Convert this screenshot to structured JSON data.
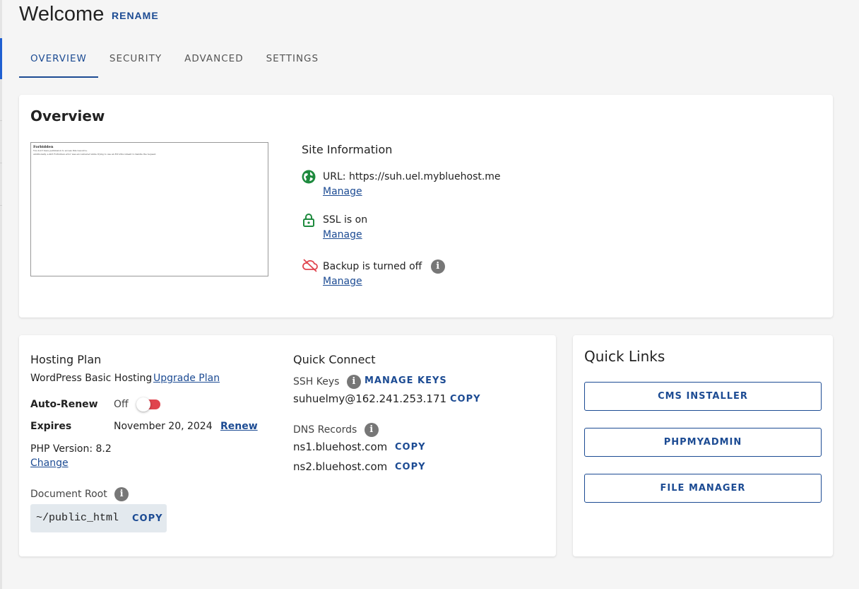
{
  "header": {
    "title": "Welcome",
    "rename_label": "RENAME"
  },
  "tabs": [
    {
      "label": "OVERVIEW",
      "active": true
    },
    {
      "label": "SECURITY",
      "active": false
    },
    {
      "label": "ADVANCED",
      "active": false
    },
    {
      "label": "SETTINGS",
      "active": false
    }
  ],
  "overview": {
    "title": "Overview",
    "preview": {
      "heading": "Forbidden",
      "lines": [
        "You don't have permission to access this resource.",
        "Additionally, a 403 Forbidden error was encountered while trying to use an ErrorDocument to handle the request."
      ]
    },
    "site_info": {
      "title": "Site Information",
      "url_label": "URL: https://suh.uel.mybluehost.me",
      "ssl_label": "SSL is on",
      "backup_label": "Backup is turned off",
      "manage_label": "Manage",
      "info_glyph": "i"
    }
  },
  "hosting": {
    "title": "Hosting Plan",
    "plan_name": "WordPress Basic Hosting",
    "upgrade_label": "Upgrade Plan",
    "auto_renew_label": "Auto-Renew",
    "auto_renew_value": "Off",
    "expires_label": "Expires",
    "expires_value": "November 20, 2024",
    "renew_label": "Renew",
    "php_label": "PHP Version: 8.2",
    "php_change_label": "Change",
    "doc_root_label": "Document Root",
    "doc_root_value": "~/public_html",
    "copy_label": "COPY"
  },
  "quick_connect": {
    "title": "Quick Connect",
    "ssh_label": "SSH Keys",
    "manage_keys_label": "MANAGE KEYS",
    "ssh_value": "suhuelmy@162.241.253.171",
    "dns_label": "DNS Records",
    "ns1": "ns1.bluehost.com",
    "ns2": "ns2.bluehost.com",
    "copy_label": "COPY"
  },
  "quick_links": {
    "title": "Quick Links",
    "buttons": [
      "CMS INSTALLER",
      "PHPMYADMIN",
      "FILE MANAGER"
    ]
  },
  "colors": {
    "accent": "#1c4b93",
    "success": "#1e8a3e",
    "danger": "#e0444e"
  },
  "icons": {
    "url": "globe-icon",
    "ssl": "lock-icon",
    "backup": "cloud-off-icon",
    "info": "info-icon"
  }
}
